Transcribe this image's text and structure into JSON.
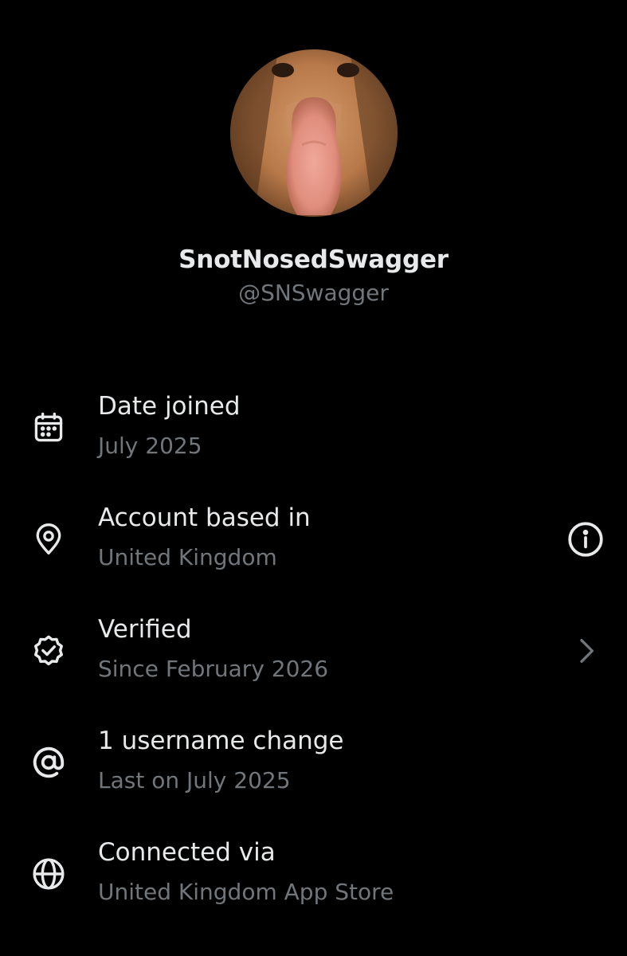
{
  "profile": {
    "display_name": "SnotNosedSwagger",
    "handle": "@SNSwagger"
  },
  "colors": {
    "background": "#000000",
    "primary_text": "#e7e9ea",
    "secondary_text": "#71767b"
  },
  "rows": [
    {
      "icon": "calendar-icon",
      "title": "Date joined",
      "subtitle": "July 2025"
    },
    {
      "icon": "location-pin-icon",
      "title": "Account based in",
      "subtitle": "United Kingdom",
      "action": "info-icon"
    },
    {
      "icon": "verified-badge-icon",
      "title": "Verified",
      "subtitle": "Since February 2026",
      "action": "chevron-right-icon"
    },
    {
      "icon": "at-sign-icon",
      "title": "1 username change",
      "subtitle": "Last on July 2025"
    },
    {
      "icon": "globe-icon",
      "title": "Connected via",
      "subtitle": "United Kingdom App Store"
    }
  ]
}
